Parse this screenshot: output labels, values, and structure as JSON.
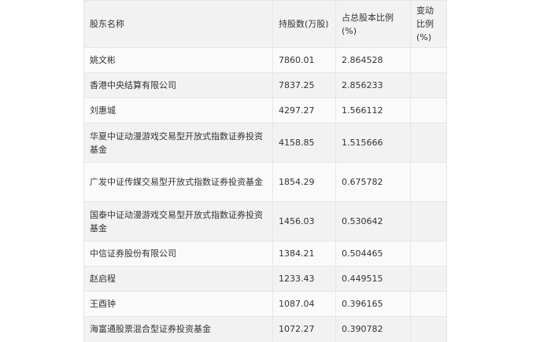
{
  "table": {
    "headers": [
      "股东名称",
      "持股数(万股)",
      "占总股本比例(%)",
      "变动比例(%)"
    ],
    "rows": [
      {
        "name": "姚文彬",
        "shares": "7860.01",
        "ratio": "2.864528",
        "change": ""
      },
      {
        "name": "香港中央结算有限公司",
        "shares": "7837.25",
        "ratio": "2.856233",
        "change": ""
      },
      {
        "name": "刘惠城",
        "shares": "4297.27",
        "ratio": "1.566112",
        "change": ""
      },
      {
        "name": "华夏中证动漫游戏交易型开放式指数证券投资基金",
        "shares": "4158.85",
        "ratio": "1.515666",
        "change": ""
      },
      {
        "name": "广发中证传媒交易型开放式指数证券投资基金",
        "shares": "1854.29",
        "ratio": "0.675782",
        "change": ""
      },
      {
        "name": "国泰中证动漫游戏交易型开放式指数证券投资基金",
        "shares": "1456.03",
        "ratio": "0.530642",
        "change": ""
      },
      {
        "name": "中信证券股份有限公司",
        "shares": "1384.21",
        "ratio": "0.504465",
        "change": ""
      },
      {
        "name": "赵启程",
        "shares": "1233.43",
        "ratio": "0.449515",
        "change": ""
      },
      {
        "name": "王酉钟",
        "shares": "1087.04",
        "ratio": "0.396165",
        "change": ""
      },
      {
        "name": "海富通股票混合型证券投资基金",
        "shares": "1072.27",
        "ratio": "0.390782",
        "change": ""
      }
    ]
  }
}
